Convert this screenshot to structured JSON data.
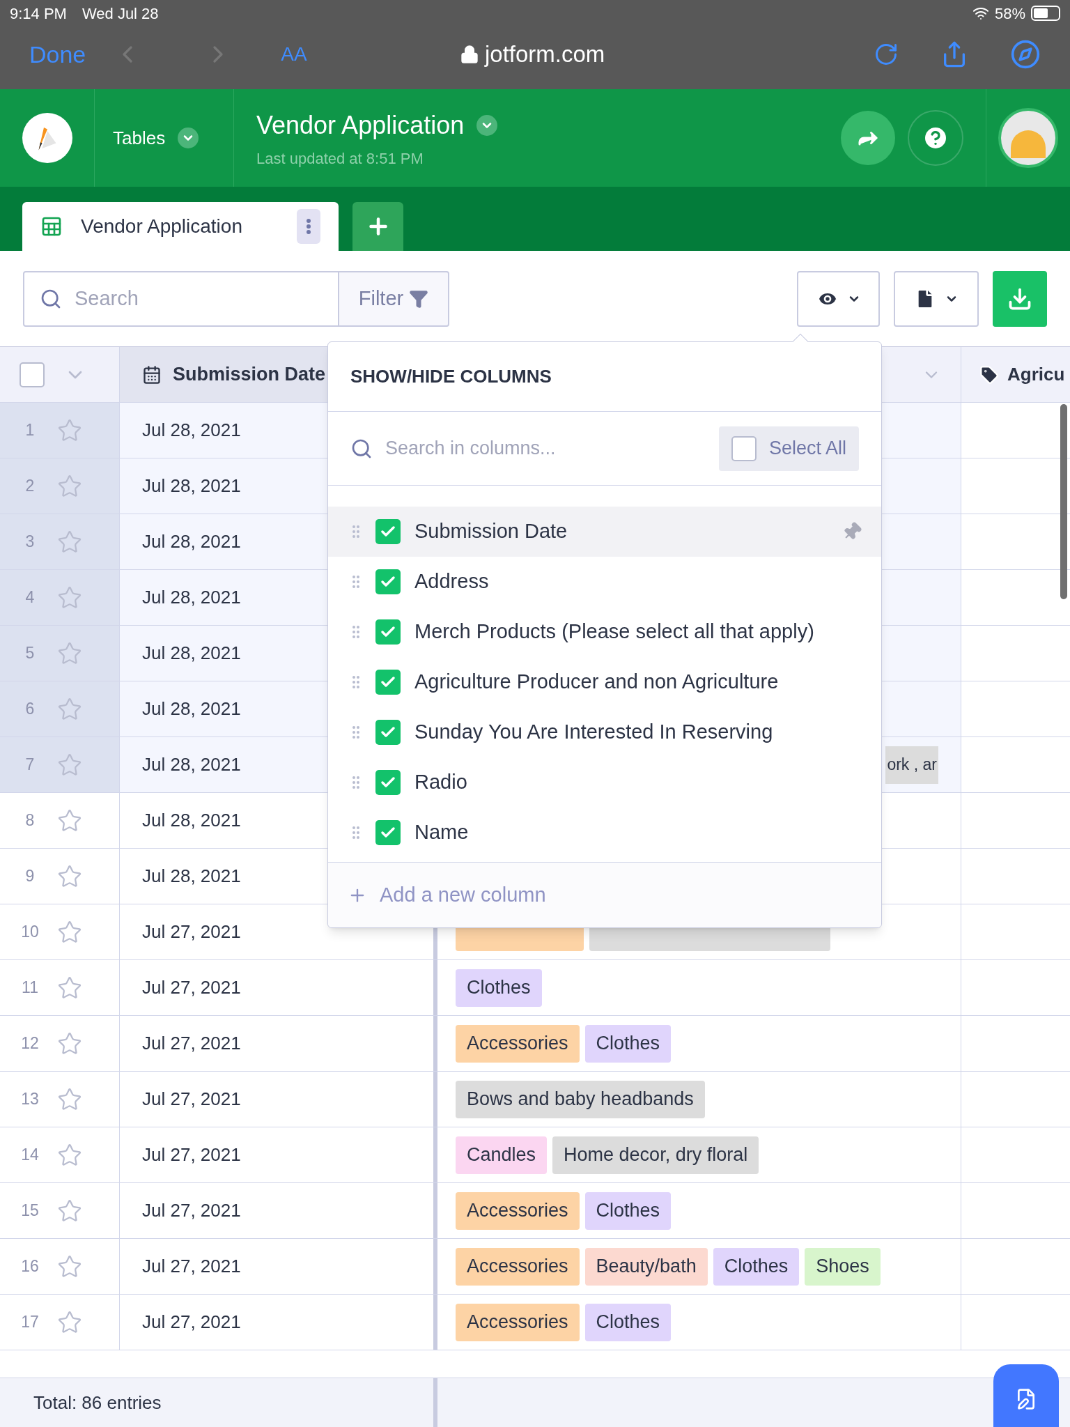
{
  "status_bar": {
    "time": "9:14 PM",
    "date": "Wed Jul 28",
    "battery": "58%"
  },
  "browser": {
    "done": "Done",
    "text_size": "AA",
    "url": "jotform.com"
  },
  "app_header": {
    "section": "Tables",
    "title": "Vendor Application",
    "subtitle": "Last updated at 8:51 PM"
  },
  "tabs": [
    {
      "label": "Vendor Application",
      "selected": true
    }
  ],
  "toolbar": {
    "search_placeholder": "Search",
    "filter": "Filter"
  },
  "table": {
    "select_all_checked": false,
    "columns": [
      {
        "label": "Submission Date"
      },
      {
        "label": "Agricu"
      }
    ],
    "rows": [
      {
        "number": "1",
        "date": "Jul 28, 2021",
        "highlighted": true,
        "tags": []
      },
      {
        "number": "2",
        "date": "Jul 28, 2021",
        "highlighted": true,
        "tags": []
      },
      {
        "number": "3",
        "date": "Jul 28, 2021",
        "highlighted": true,
        "tags": []
      },
      {
        "number": "4",
        "date": "Jul 28, 2021",
        "highlighted": true,
        "tags": []
      },
      {
        "number": "5",
        "date": "Jul 28, 2021",
        "highlighted": true,
        "tags": []
      },
      {
        "number": "6",
        "date": "Jul 28, 2021",
        "highlighted": true,
        "tags": []
      },
      {
        "number": "7",
        "date": "Jul 28, 2021",
        "highlighted": true,
        "cut_tag": "ork , ar",
        "tags": []
      },
      {
        "number": "8",
        "date": "Jul 28, 2021",
        "highlighted": false,
        "tags": []
      },
      {
        "number": "9",
        "date": "Jul 28, 2021",
        "highlighted": false,
        "tags": []
      },
      {
        "number": "10",
        "date": "Jul 27, 2021",
        "highlighted": false,
        "tags": [],
        "covered_tags": [
          {
            "color": "#fdd3a5"
          },
          {
            "color": "#dcdcdc"
          }
        ]
      },
      {
        "number": "11",
        "date": "Jul 27, 2021",
        "highlighted": false,
        "tags": [
          {
            "label": "Clothes",
            "color": "#e0d5fc"
          }
        ]
      },
      {
        "number": "12",
        "date": "Jul 27, 2021",
        "highlighted": false,
        "tags": [
          {
            "label": "Accessories",
            "color": "#fdd3a5"
          },
          {
            "label": "Clothes",
            "color": "#e0d5fc"
          }
        ]
      },
      {
        "number": "13",
        "date": "Jul 27, 2021",
        "highlighted": false,
        "tags": [
          {
            "label": "Bows and baby headbands",
            "color": "#dcdcdc"
          }
        ]
      },
      {
        "number": "14",
        "date": "Jul 27, 2021",
        "highlighted": false,
        "tags": [
          {
            "label": "Candles",
            "color": "#fbd6f1"
          },
          {
            "label": "Home decor, dry floral",
            "color": "#dcdcdc"
          }
        ]
      },
      {
        "number": "15",
        "date": "Jul 27, 2021",
        "highlighted": false,
        "tags": [
          {
            "label": "Accessories",
            "color": "#fdd3a5"
          },
          {
            "label": "Clothes",
            "color": "#e0d5fc"
          }
        ]
      },
      {
        "number": "16",
        "date": "Jul 27, 2021",
        "highlighted": false,
        "tags": [
          {
            "label": "Accessories",
            "color": "#fdd3a5"
          },
          {
            "label": "Beauty/bath",
            "color": "#fcd9d0"
          },
          {
            "label": "Clothes",
            "color": "#e0d5fc"
          },
          {
            "label": "Shoes",
            "color": "#d8f5cc"
          }
        ]
      },
      {
        "number": "17",
        "date": "Jul 27, 2021",
        "highlighted": false,
        "tags": [
          {
            "label": "Accessories",
            "color": "#fdd3a5"
          },
          {
            "label": "Clothes",
            "color": "#e0d5fc"
          }
        ]
      }
    ]
  },
  "popover": {
    "title": "SHOW/HIDE COLUMNS",
    "search_placeholder": "Search in columns...",
    "select_all": {
      "label": "Select All",
      "checked": false
    },
    "items": [
      {
        "label": "Submission Date",
        "checked": true,
        "pinned": true
      },
      {
        "label": "Address",
        "checked": true,
        "pinned": false
      },
      {
        "label": "Merch Products (Please select all that apply)",
        "checked": true,
        "pinned": false
      },
      {
        "label": "Agriculture Producer and non Agriculture",
        "checked": true,
        "pinned": false
      },
      {
        "label": "Sunday You Are Interested In Reserving",
        "checked": true,
        "pinned": false
      },
      {
        "label": "Radio",
        "checked": true,
        "pinned": false
      },
      {
        "label": "Name",
        "checked": true,
        "pinned": false
      }
    ],
    "add": "Add a new column"
  },
  "footer": {
    "total": "Total: 86 entries"
  }
}
